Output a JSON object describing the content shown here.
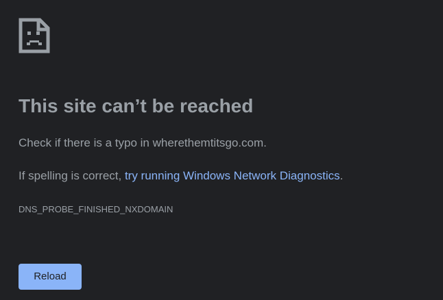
{
  "colors": {
    "background": "#202124",
    "text": "#9aa0a6",
    "link": "#8ab4f8",
    "button_background": "#8ab4f8",
    "button_text": "#202124"
  },
  "error": {
    "icon": "sad-page-icon",
    "title": "This site can’t be reached",
    "typo_prefix": "Check if there is a typo in ",
    "domain": "wherethemtitsgo.com",
    "typo_suffix": ".",
    "spelling_prefix": "If spelling is correct, ",
    "diagnostics_link": "try running Windows Network Diagnostics",
    "spelling_suffix": ".",
    "code": "DNS_PROBE_FINISHED_NXDOMAIN"
  },
  "actions": {
    "reload_label": "Reload"
  }
}
